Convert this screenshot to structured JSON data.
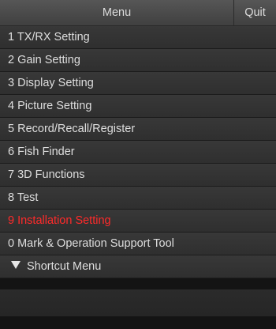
{
  "header": {
    "title": "Menu",
    "quit_label": "Quit"
  },
  "menu": {
    "items": [
      {
        "label": "1 TX/RX Setting"
      },
      {
        "label": "2 Gain Setting"
      },
      {
        "label": "3 Display Setting"
      },
      {
        "label": "4 Picture Setting"
      },
      {
        "label": "5 Record/Recall/Register"
      },
      {
        "label": "6 Fish Finder"
      },
      {
        "label": "7 3D Functions"
      },
      {
        "label": "8 Test"
      },
      {
        "label": "9 Installation Setting",
        "highlight_color": "#ff2a2a"
      },
      {
        "label": "0 Mark & Operation Support Tool"
      }
    ],
    "shortcut": {
      "label": "Shortcut Menu",
      "icon": "triangle-down-icon"
    }
  },
  "colors": {
    "background": "#141414",
    "item_text": "#dedede",
    "highlight": "#ff2a2a"
  }
}
